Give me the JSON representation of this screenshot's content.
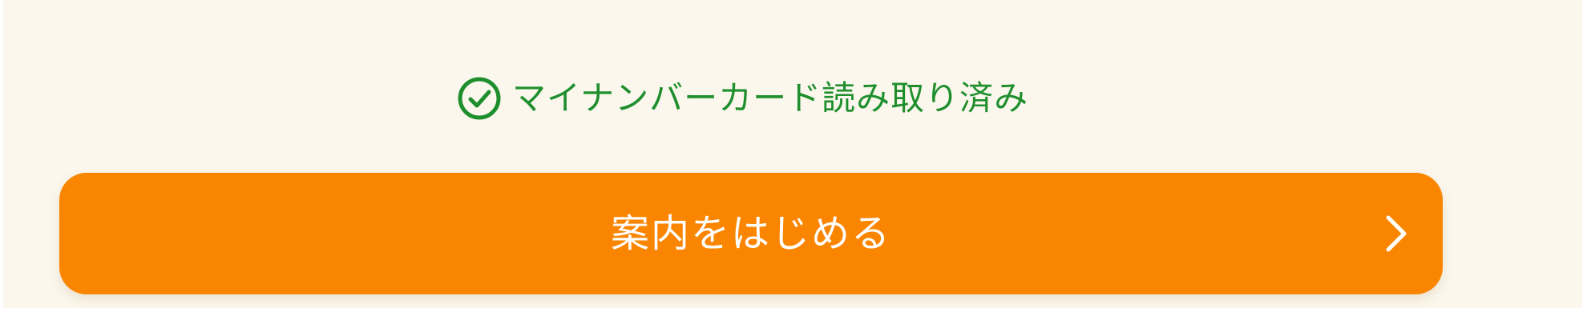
{
  "status": {
    "icon": "check-circle-icon",
    "text": "マイナンバーカード読み取り済み",
    "color": "#1f8f2e"
  },
  "start_button": {
    "label": "案内をはじめる",
    "icon": "chevron-right-icon",
    "color": "#fa8500"
  },
  "colors": {
    "background": "#fbf7ec",
    "button_text": "#ffffff"
  }
}
